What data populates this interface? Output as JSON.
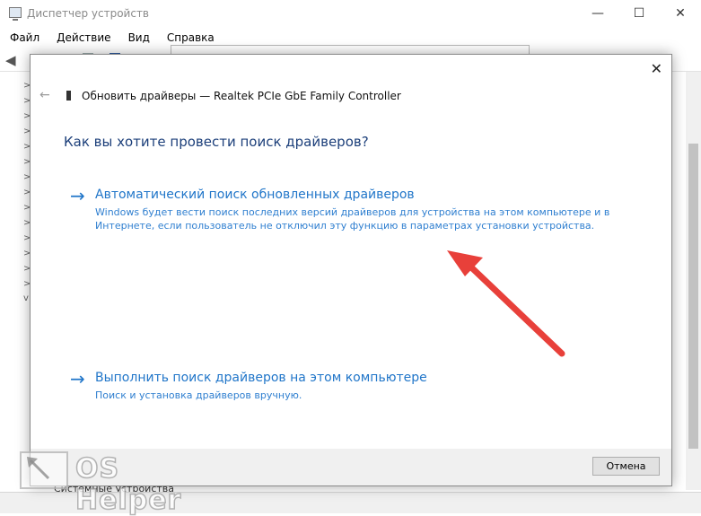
{
  "window": {
    "title": "Диспетчер устройств",
    "controls": [
      "—",
      "☐",
      "✕"
    ]
  },
  "menu": [
    "Файл",
    "Действие",
    "Вид",
    "Справка"
  ],
  "tree_glyphs": [
    ">",
    ">",
    ">",
    ">",
    ">",
    ">",
    ">",
    ">",
    ">",
    ">",
    ">",
    ">",
    ">",
    ">",
    "v"
  ],
  "bottom_item": "Системные устройства",
  "dialog": {
    "close_glyph": "✕",
    "back_glyph": "←",
    "header": "Обновить драйверы — Realtek PCIe GbE Family Controller",
    "question": "Как вы хотите провести поиск драйверов?",
    "options": [
      {
        "arrow": "→",
        "title": "Автоматический поиск обновленных драйверов",
        "description": "Windows будет вести поиск последних версий драйверов для устройства на этом компьютере и в Интернете, если пользователь не отключил эту функцию в параметрах установки устройства."
      },
      {
        "arrow": "→",
        "title": "Выполнить поиск драйверов на этом компьютере",
        "description": "Поиск и установка драйверов вручную."
      }
    ],
    "cancel_label": "Отмена"
  },
  "watermark": {
    "text": "OS Helper"
  },
  "colors": {
    "link_blue": "#2176c9",
    "question_blue": "#1c3f7a",
    "annotation_red": "#e8403a"
  },
  "icons": {
    "app": "device-manager-icon",
    "device": "network-adapter-icon",
    "annotation": "red-arrow-icon"
  }
}
